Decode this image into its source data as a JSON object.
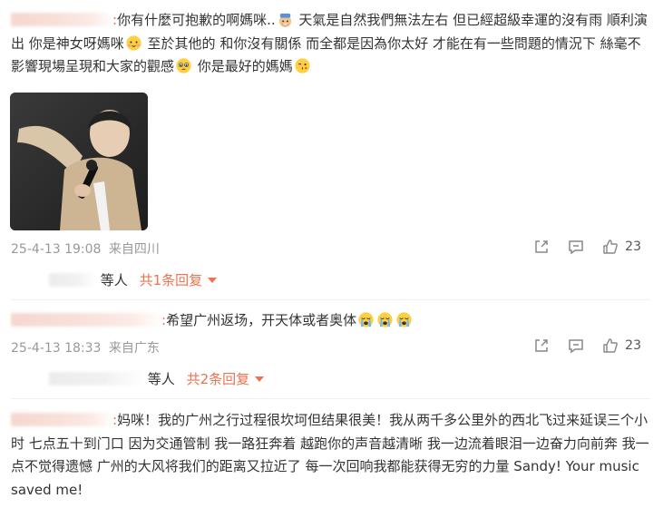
{
  "comments": [
    {
      "prefix": ":",
      "text_a": "你有什麼可抱歉的啊媽咪..",
      "text_b": " 天氣是自然我們無法左右 但已經超級幸運的沒有雨 順利演出 你是神女呀媽咪",
      "text_c": " 至於其他的 和你沒有關係 而全都是因為你太好 才能在有一些問題的情況下 絲毫不影響現場呈現和大家的觀感",
      "text_d": " 你是最好的媽媽",
      "time": "25-4-13 19:08",
      "source": "来自四川",
      "likes": "23",
      "reply_suffix": "等人",
      "reply_count": "共1条回复"
    },
    {
      "prefix": ":",
      "text_a": "希望广州返场，开天体或者奥体",
      "time": "25-4-13 18:33",
      "source": "来自广东",
      "likes": "23",
      "reply_suffix": "等人",
      "reply_count": "共2条回复"
    },
    {
      "prefix": ":",
      "text_a": "妈咪！我的广州之行过程很坎坷但结果很美！我从两千多公里外的西北飞过来延误三个小时 七点五十到门口 因为交通管制 我一路狂奔着  越跑你的声音越清晰 我一边流着眼泪一边奋力向前奔 我一点不觉得遗憾 广州的大风将我们的距离又拉近了 每一次回响我都能获得无穷的力量 Sandy! Your music saved me!"
    }
  ],
  "icons": [
    "share-icon",
    "comment-icon",
    "like-icon"
  ],
  "colors": {
    "accent": "#eb7350",
    "meta": "#999999",
    "text": "#333333"
  }
}
